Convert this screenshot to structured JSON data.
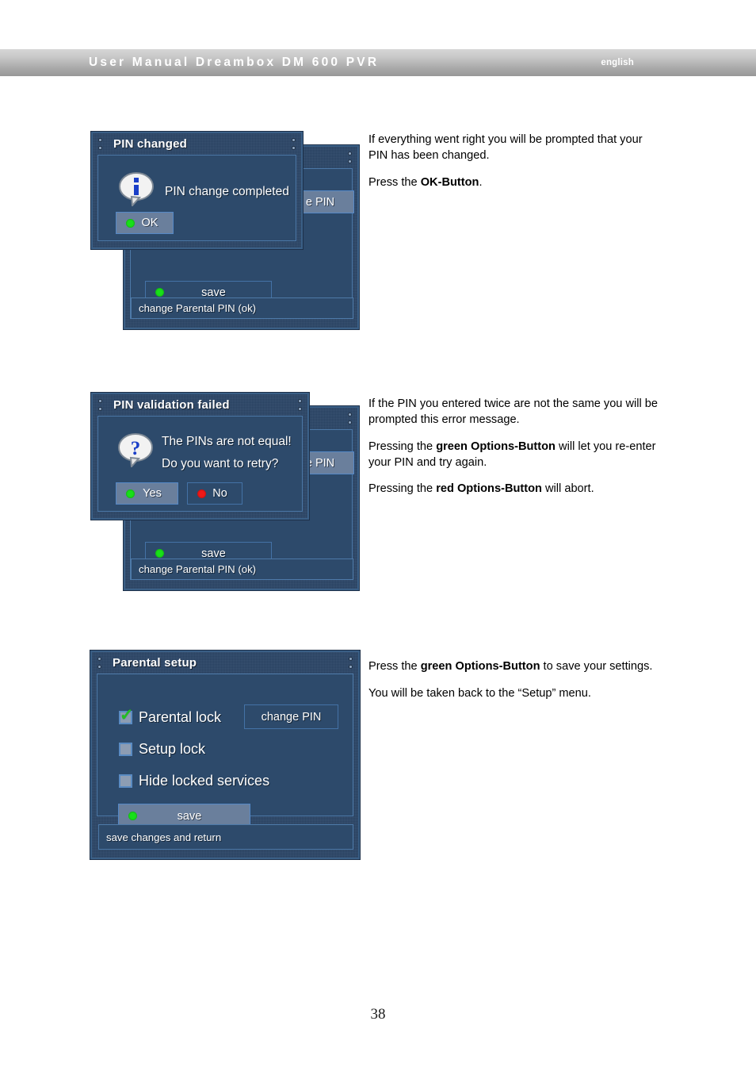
{
  "header": {
    "title": "User Manual Dreambox DM 600 PVR",
    "language": "english"
  },
  "page_number": "38",
  "sections": [
    {
      "id": "pin-changed",
      "dialog": {
        "title": "PIN changed",
        "message": "PIN change completed",
        "icon": "info-bubble-icon",
        "buttons": [
          {
            "label": "OK",
            "led": "green"
          }
        ]
      },
      "background_dialog": {
        "partial_button": "e PIN",
        "save_button": {
          "label": "save",
          "led": "green"
        },
        "statusline": "change Parental PIN (ok)"
      },
      "copy": [
        {
          "runs": [
            {
              "text": "If everything went right you will be prompted that your PIN has been changed.",
              "bold": false
            }
          ]
        },
        {
          "runs": [
            {
              "text": "Press the ",
              "bold": false
            },
            {
              "text": "OK-Button",
              "bold": true
            },
            {
              "text": ".",
              "bold": false
            }
          ]
        }
      ]
    },
    {
      "id": "pin-validation-failed",
      "dialog": {
        "title": "PIN validation failed",
        "icon": "question-bubble-icon",
        "message_line_1": "The PINs are not equal!",
        "message_line_2": "Do you want to retry?",
        "buttons": [
          {
            "label": "Yes",
            "led": "green"
          },
          {
            "label": "No",
            "led": "red"
          }
        ]
      },
      "background_dialog": {
        "partial_button": "e PIN",
        "save_button": {
          "label": "save",
          "led": "green"
        },
        "statusline": "change Parental PIN (ok)"
      },
      "copy": [
        {
          "runs": [
            {
              "text": "If the PIN you entered twice are not the same you will be prompted this error message.",
              "bold": false
            }
          ]
        },
        {
          "runs": [
            {
              "text": "Pressing the ",
              "bold": false
            },
            {
              "text": "green Options-Button",
              "bold": true
            },
            {
              "text": " will let you re-enter your PIN and try again.",
              "bold": false
            }
          ]
        },
        {
          "runs": [
            {
              "text": "Pressing the ",
              "bold": false
            },
            {
              "text": "red Options-Button",
              "bold": true
            },
            {
              "text": " will abort.",
              "bold": false
            }
          ]
        }
      ]
    },
    {
      "id": "parental-setup",
      "dialog": {
        "title": "Parental setup",
        "checkboxes": [
          {
            "label": "Parental lock",
            "checked": true
          },
          {
            "label": "Setup lock",
            "checked": false
          },
          {
            "label": "Hide locked services",
            "checked": false
          }
        ],
        "change_pin_button": "change PIN",
        "save_button": {
          "label": "save",
          "led": "green"
        },
        "statusline": "save changes and return"
      },
      "copy": [
        {
          "runs": [
            {
              "text": "Press the ",
              "bold": false
            },
            {
              "text": "green Options-Button",
              "bold": true
            },
            {
              "text": " to save your settings.",
              "bold": false
            }
          ]
        },
        {
          "runs": [
            {
              "text": "You will be taken back to the “Setup” menu.",
              "bold": false
            }
          ]
        }
      ]
    }
  ],
  "colors": {
    "osd_background": "#2d4a6b",
    "osd_border": "#4d79a8",
    "selected_button": "#6a7f9c",
    "led_green": "#18e018",
    "led_red": "#f01818",
    "checkbox_fill": "#8d9db3",
    "checkmark": "#22c022",
    "header_gradient_top": "#d6d6d6",
    "header_gradient_bottom": "#989898"
  }
}
